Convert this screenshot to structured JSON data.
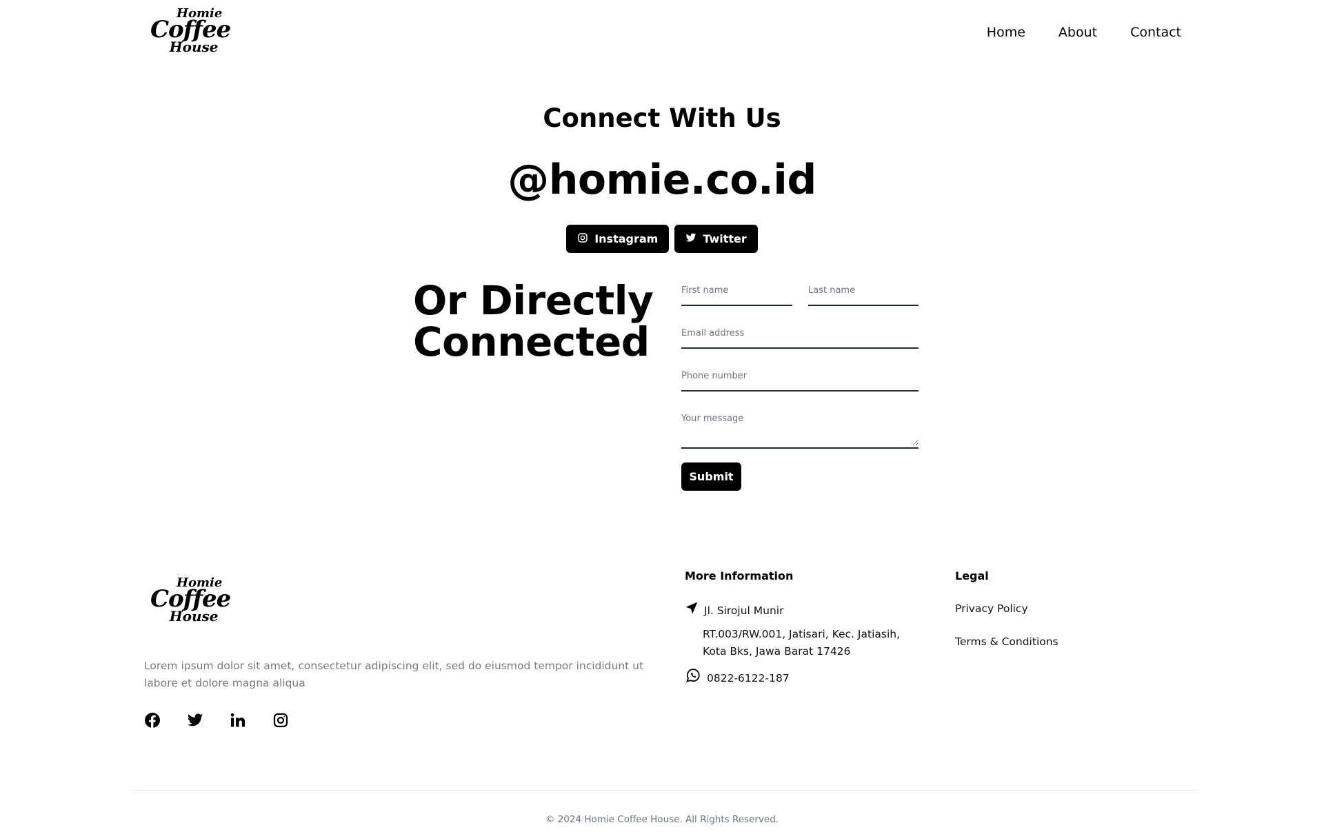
{
  "brand": {
    "logo_line1": "Homie",
    "logo_line2": "Coffee",
    "logo_line3": "House"
  },
  "nav": {
    "items": [
      {
        "label": "Home"
      },
      {
        "label": "About"
      },
      {
        "label": "Contact"
      }
    ]
  },
  "hero": {
    "title": "Connect With Us",
    "handle": "@homie.co.id",
    "buttons": [
      {
        "label": "Instagram",
        "icon": "instagram-icon"
      },
      {
        "label": "Twitter",
        "icon": "twitter-icon"
      }
    ]
  },
  "contact": {
    "title_line1": "Or Directly",
    "title_line2": "Connected",
    "first_name_placeholder": "First name",
    "last_name_placeholder": "Last name",
    "email_placeholder": "Email address",
    "phone_placeholder": "Phone number",
    "message_placeholder": "Your message",
    "submit_label": "Submit"
  },
  "footer": {
    "description": "Lorem ipsum dolor sit amet, consectetur adipiscing elit, sed do eiusmod tempor incididunt ut labore et dolore magna aliqua",
    "socials": [
      "facebook-icon",
      "twitter-icon",
      "linkedin-icon",
      "instagram-icon"
    ],
    "more_info_title": "More Information",
    "address_line1": "Jl. Sirojul Munir",
    "address_line2": "RT.003/RW.001, Jatisari, Kec. Jatiasih, Kota Bks, Jawa Barat 17426",
    "phone": "0822-6122-187",
    "legal_title": "Legal",
    "legal_links": [
      {
        "label": "Privacy Policy"
      },
      {
        "label": "Terms & Conditions"
      }
    ],
    "copyright": "© 2024 Homie Coffee House. All Rights Reserved."
  }
}
